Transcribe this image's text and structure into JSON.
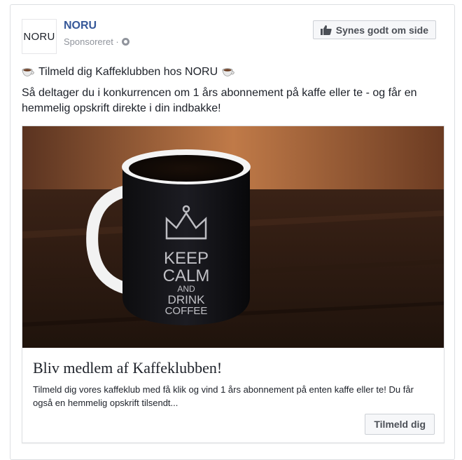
{
  "post": {
    "page_name": "NORU",
    "logo_text": "NORU",
    "sponsored_label": "Sponsoreret · ",
    "like_button_label": "Synes godt om side",
    "headline": "Tilmeld dig Kaffeklubben hos NORU",
    "body": "Så deltager du i konkurrencen om 1 års abonnement på kaffe eller te - og får en hemmelig opskrift direkte i din indbakke!"
  },
  "link": {
    "photo_mug_text": [
      "KEEP",
      "CALM",
      "AND",
      "DRINK",
      "COFFEE"
    ],
    "title": "Bliv medlem af Kaffeklubben!",
    "description": "Tilmeld dig vores kaffeklub med få klik og vind 1 års abonnement på enten kaffe eller te! Du får også en hemmelig opskrift tilsendt...",
    "cta_label": "Tilmeld dig"
  },
  "icons": {
    "like": "thumbs-up-icon",
    "audience": "globe-icon",
    "emoji": "coffee-cup-emoji"
  },
  "colors": {
    "link_blue": "#365899",
    "muted": "#90949c",
    "button_bg": "#f6f7f9",
    "border": "#dddfe2"
  }
}
